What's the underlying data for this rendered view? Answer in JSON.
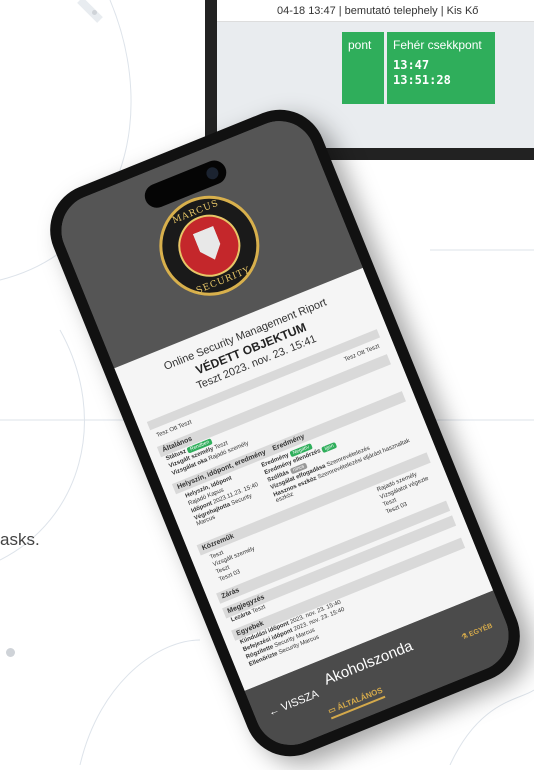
{
  "background": {
    "side_text": "asks."
  },
  "monitor": {
    "topbar_text": "04-18 13:47 | bemutató telephely | Kis Kő",
    "checkpoint_prev_label": "pont",
    "checkpoint": {
      "label": "Fehér csekkpont",
      "time1": "13:47",
      "time2": "13:51:28"
    }
  },
  "phone": {
    "logo": {
      "top_text": "MARCUS",
      "bottom_text": "SECURITY"
    },
    "report": {
      "title": "Online Security Management Riport",
      "object": "VÉDETT OBJEKTUM",
      "subtitle": "Teszt 2023. nov. 23. 15:41",
      "sections": {
        "general": "Általános",
        "location": "Helyszín, időpont, eredmény",
        "result": "Eredmény",
        "participants": "Közreműk",
        "closing": "Zárás",
        "signature": "Megjegyzés",
        "other": "Egyebek"
      },
      "fields": {
        "ok_label": "Státusz",
        "ok_badge": "Rendben",
        "user1": "Tesz Ott Teszt",
        "user2": "Tesz Ott Teszt",
        "person_label": "Vizsgált személy",
        "person_value": "Teszt",
        "check_label": "Vizsgálat oka",
        "check_value": "Rajadó személy",
        "place_label": "Helyszín, időpont",
        "place_value": "Rajadó Kapus",
        "time_label": "Időpont",
        "time_value": "2023.11.23. 15:40",
        "exec_label": "Végrehajtotta",
        "exec_value": "Security Marcus",
        "result_label": "Eredmény",
        "result_badge": "Negatív",
        "res2_label": "Eredmény ellenőrzés",
        "res2_badge": "igen",
        "witness_label": "Szólítás",
        "witness_badge": "nincs",
        "accept_label": "Vizsgálat elfogadása",
        "accept_value": "Szemrevételezés",
        "note_label": "Hasznos eszköz",
        "note_value": "Szemrevételezési eljárást hasznaltak eszköz",
        "p_left1": "Teszt",
        "p_left2": "Vizsgált személy",
        "p_left3": "Teszt",
        "p_left4": "Teszt 03",
        "p_right1": "Rajadó személy",
        "p_right2": "Vizsgálatot végezte",
        "p_right3": "Teszt",
        "p_right4": "Teszt 03",
        "sig_label": "Lezárta",
        "sig_value": "Teszt",
        "o1_label": "Kiindulási időpont",
        "o1_value": "2023. nov. 23. 15:40",
        "o2_label": "Befejezési időpont",
        "o2_value": "2023. nov. 23. 15:40",
        "o3_label": "Rögzítette",
        "o3_value": "Security Marcus",
        "o4_label": "Ellenőrizte",
        "o4_value": "Security Marcus"
      }
    },
    "footer": {
      "back_label": "VISSZA",
      "title": "Akoholszonda",
      "other_label": "EGYÉB",
      "tab_label": "ÁLTALÁNOS"
    }
  }
}
